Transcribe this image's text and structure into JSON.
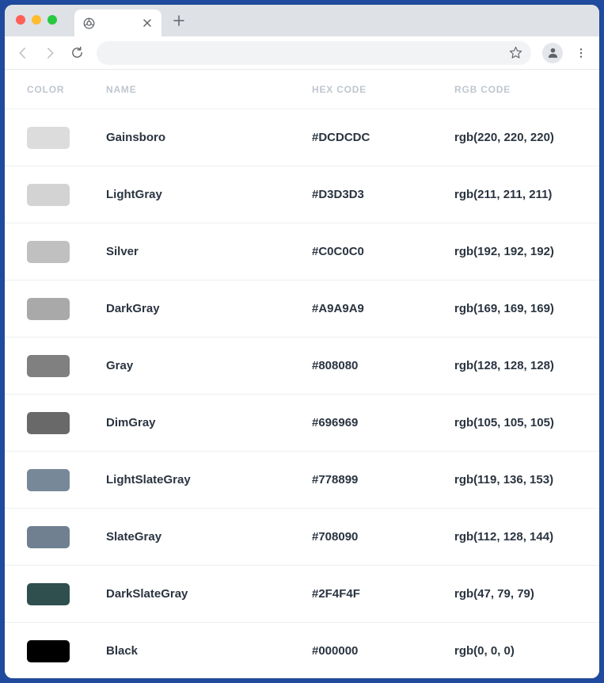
{
  "headers": {
    "color": "COLOR",
    "name": "NAME",
    "hex": "HEX CODE",
    "rgb": "RGB CODE"
  },
  "rows": [
    {
      "name": "Gainsboro",
      "hex": "#DCDCDC",
      "rgb": "rgb(220, 220, 220)",
      "swatch": "#DCDCDC"
    },
    {
      "name": "LightGray",
      "hex": "#D3D3D3",
      "rgb": "rgb(211, 211, 211)",
      "swatch": "#D3D3D3"
    },
    {
      "name": "Silver",
      "hex": "#C0C0C0",
      "rgb": "rgb(192, 192, 192)",
      "swatch": "#C0C0C0"
    },
    {
      "name": "DarkGray",
      "hex": "#A9A9A9",
      "rgb": "rgb(169, 169, 169)",
      "swatch": "#A9A9A9"
    },
    {
      "name": "Gray",
      "hex": "#808080",
      "rgb": "rgb(128, 128, 128)",
      "swatch": "#808080"
    },
    {
      "name": "DimGray",
      "hex": "#696969",
      "rgb": "rgb(105, 105, 105)",
      "swatch": "#696969"
    },
    {
      "name": "LightSlateGray",
      "hex": "#778899",
      "rgb": "rgb(119, 136, 153)",
      "swatch": "#778899"
    },
    {
      "name": "SlateGray",
      "hex": "#708090",
      "rgb": "rgb(112, 128, 144)",
      "swatch": "#708090"
    },
    {
      "name": "DarkSlateGray",
      "hex": "#2F4F4F",
      "rgb": "rgb(47, 79, 79)",
      "swatch": "#2F4F4F"
    },
    {
      "name": "Black",
      "hex": "#000000",
      "rgb": "rgb(0, 0, 0)",
      "swatch": "#000000"
    }
  ]
}
